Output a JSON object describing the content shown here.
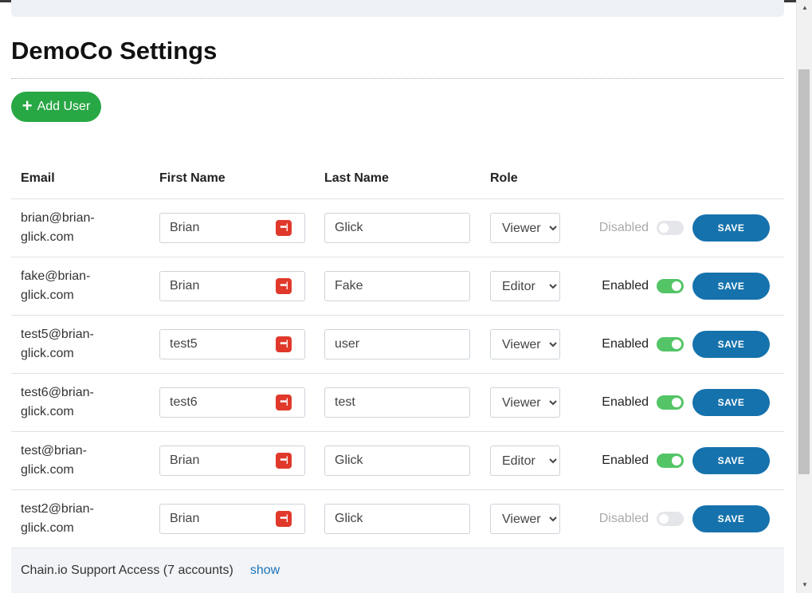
{
  "page": {
    "title": "DemoCo Settings"
  },
  "toolbar": {
    "add_user_label": "Add User"
  },
  "table": {
    "headers": {
      "email": "Email",
      "first_name": "First Name",
      "last_name": "Last Name",
      "role": "Role"
    },
    "rows": [
      {
        "email_line1": "brian@brian-",
        "email_line2": "glick.com",
        "first_name": "Brian",
        "last_name": "Glick",
        "role": "Viewer",
        "status": "Disabled",
        "enabled": false,
        "save_label": "SAVE"
      },
      {
        "email_line1": "fake@brian-",
        "email_line2": "glick.com",
        "first_name": "Brian",
        "last_name": "Fake",
        "role": "Editor",
        "status": "Enabled",
        "enabled": true,
        "save_label": "SAVE"
      },
      {
        "email_line1": "test5@brian-",
        "email_line2": "glick.com",
        "first_name": "test5",
        "last_name": "user",
        "role": "Viewer",
        "status": "Enabled",
        "enabled": true,
        "save_label": "SAVE"
      },
      {
        "email_line1": "test6@brian-",
        "email_line2": "glick.com",
        "first_name": "test6",
        "last_name": "test",
        "role": "Viewer",
        "status": "Enabled",
        "enabled": true,
        "save_label": "SAVE"
      },
      {
        "email_line1": "test@brian-",
        "email_line2": "glick.com",
        "first_name": "Brian",
        "last_name": "Glick",
        "role": "Editor",
        "status": "Enabled",
        "enabled": true,
        "save_label": "SAVE"
      },
      {
        "email_line1": "test2@brian-",
        "email_line2": "glick.com",
        "first_name": "Brian",
        "last_name": "Glick",
        "role": "Viewer",
        "status": "Disabled",
        "enabled": false,
        "save_label": "SAVE"
      }
    ]
  },
  "support": {
    "text": "Chain.io Support Access (7 accounts)",
    "show_label": "show"
  },
  "icons": {
    "add": "plus-icon",
    "password_manager": "password-manager-icon"
  },
  "colors": {
    "add_button": "#28a745",
    "save_button": "#1572ac",
    "toggle_on": "#54c567",
    "password_icon": "#e0392b",
    "link": "#1a73b8"
  }
}
